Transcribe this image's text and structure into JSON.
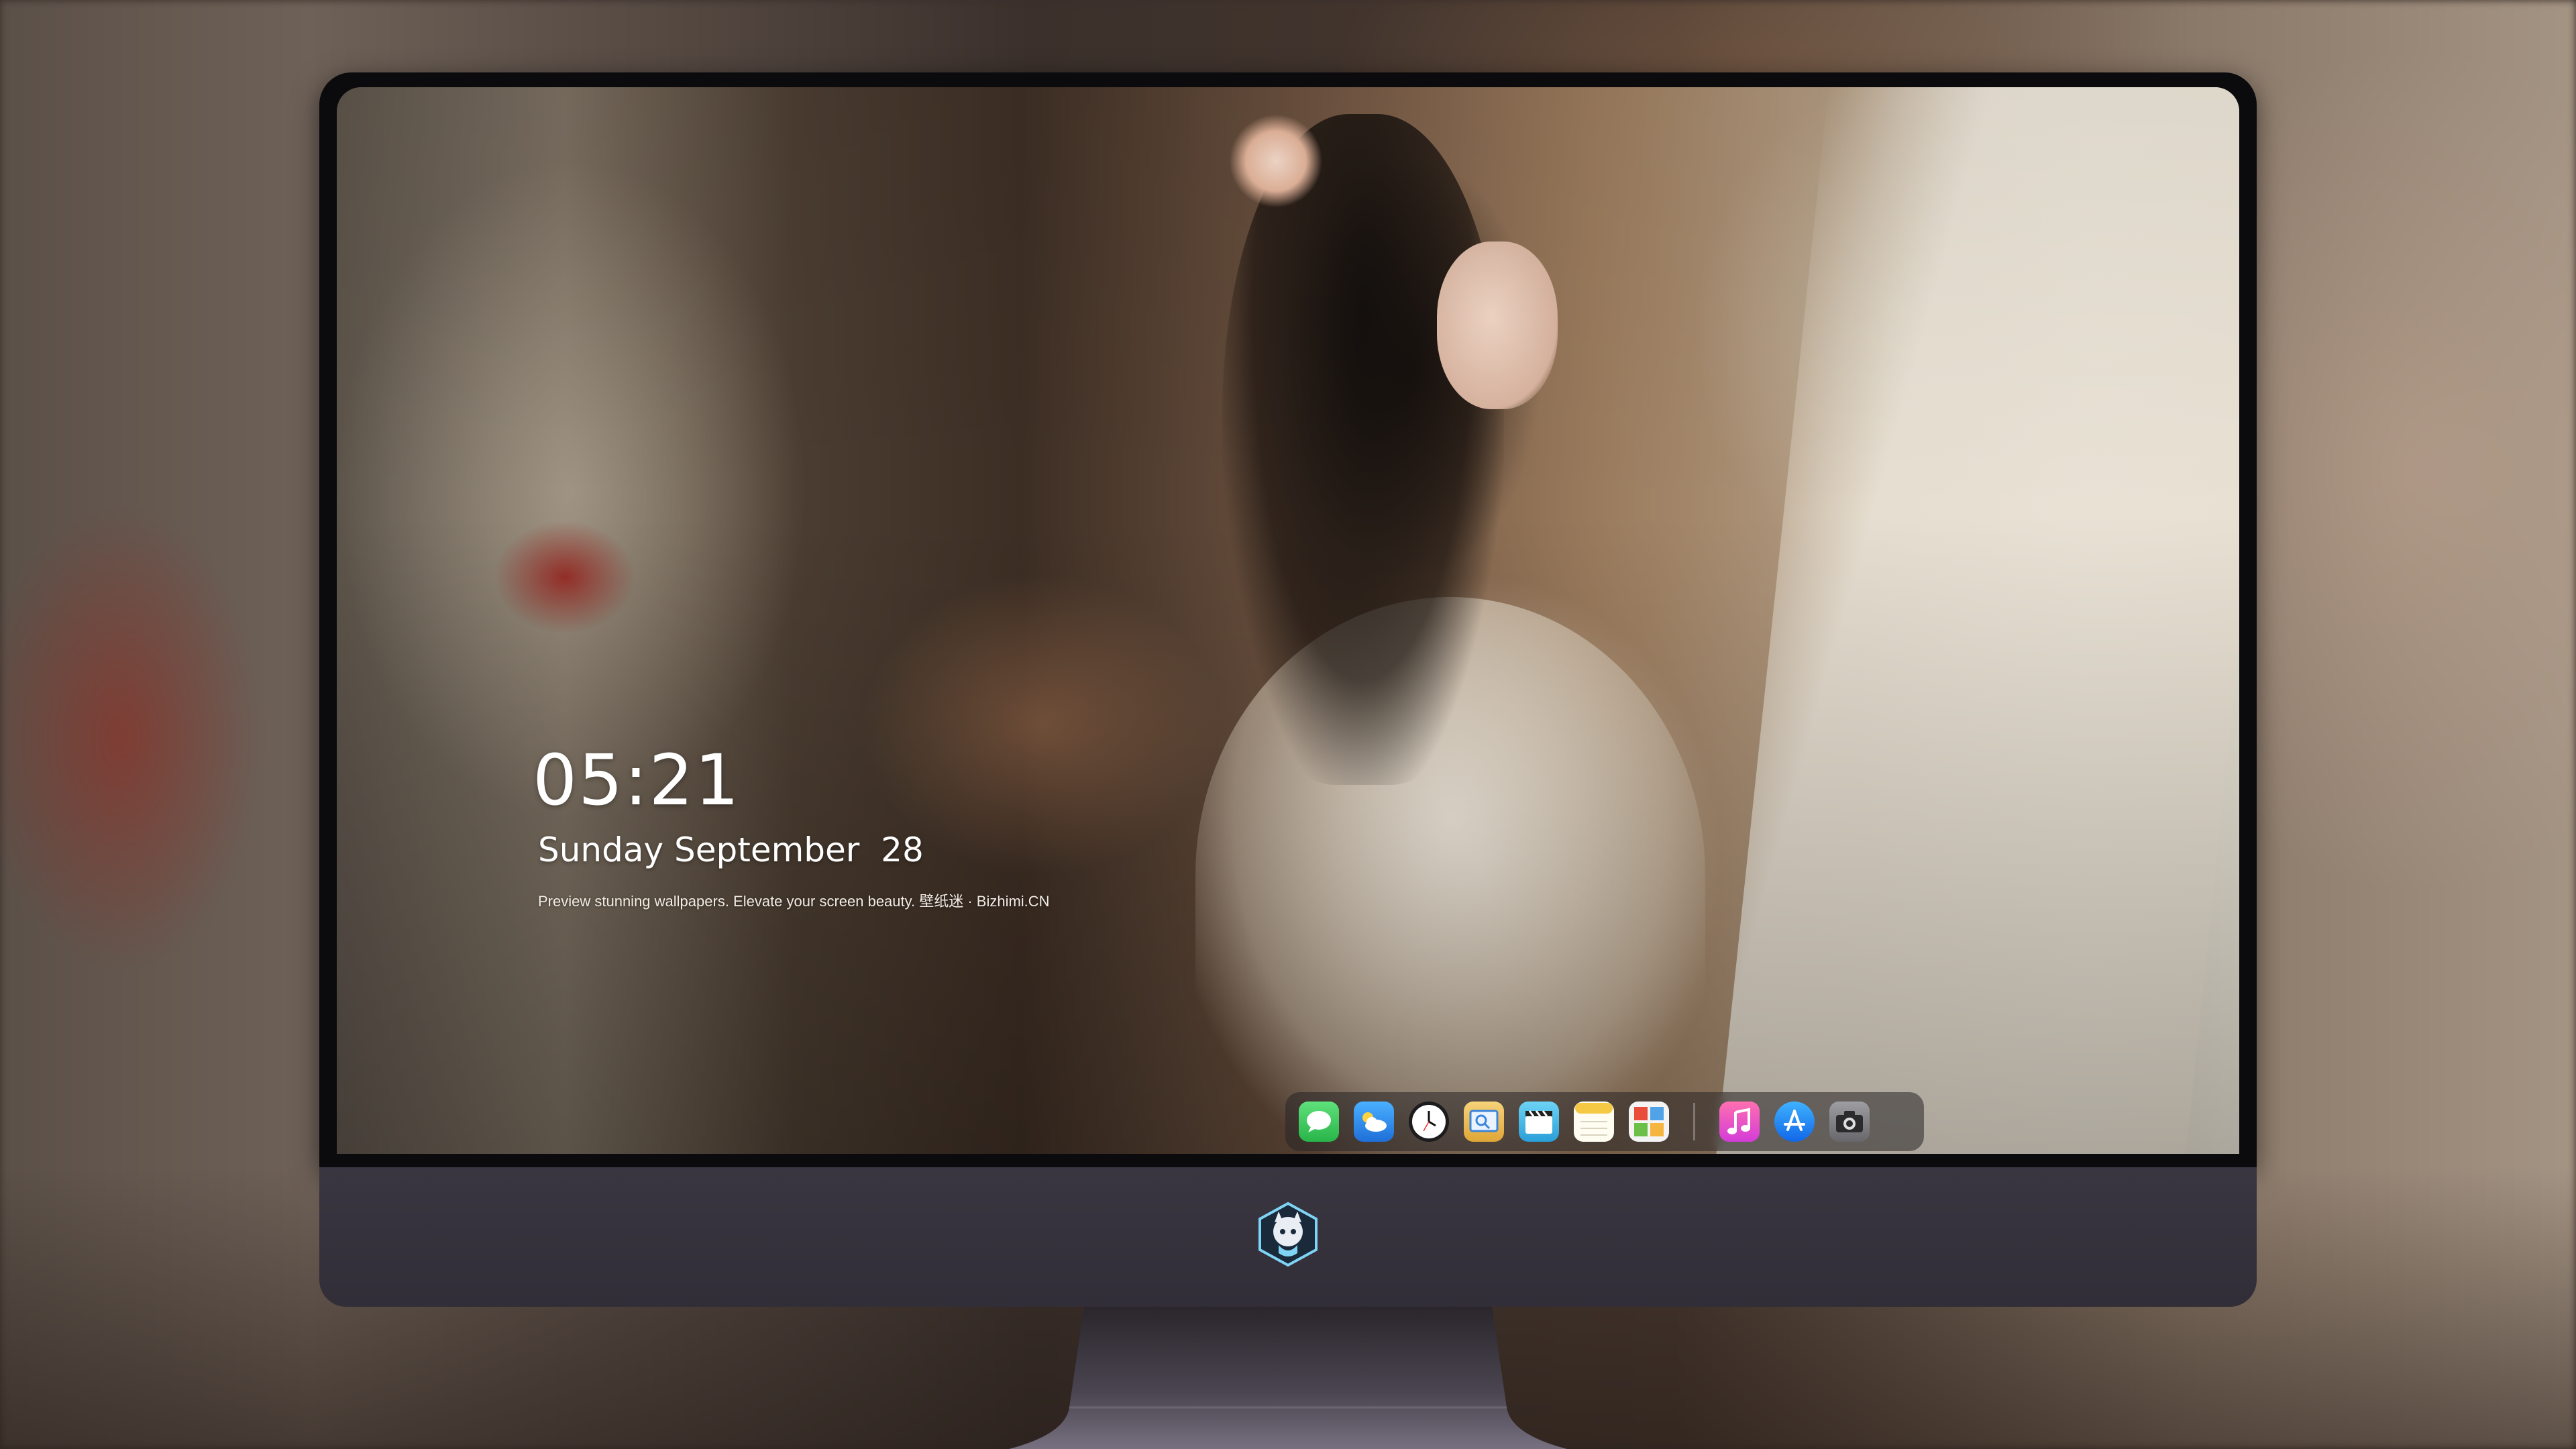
{
  "lockscreen": {
    "time": "05:21",
    "date": "Sunday September  28",
    "tagline": "Preview stunning wallpapers. Elevate your screen beauty. 壁纸迷 · Bizhimi.CN"
  },
  "dock": {
    "apps": [
      {
        "name": "messages-icon",
        "color": "#34c759"
      },
      {
        "name": "weather-icon",
        "color": "#2f8cf0"
      },
      {
        "name": "clock-icon",
        "color": "#ffffff"
      },
      {
        "name": "preview-icon",
        "color": "#e9b64a"
      },
      {
        "name": "clips-icon",
        "color": "#38b6e8"
      },
      {
        "name": "notes-icon",
        "color": "#f6d65a"
      },
      {
        "name": "photo-booth-icon",
        "color": "#4fa3e6"
      },
      {
        "name": "music-icon",
        "color": "#f24d9b"
      },
      {
        "name": "app-store-icon",
        "color": "#1f8bf5"
      },
      {
        "name": "camera-icon",
        "color": "#8a8a8e"
      }
    ]
  },
  "monitor": {
    "chin_color": "#36323c",
    "logo": "mascot-logo-icon"
  }
}
